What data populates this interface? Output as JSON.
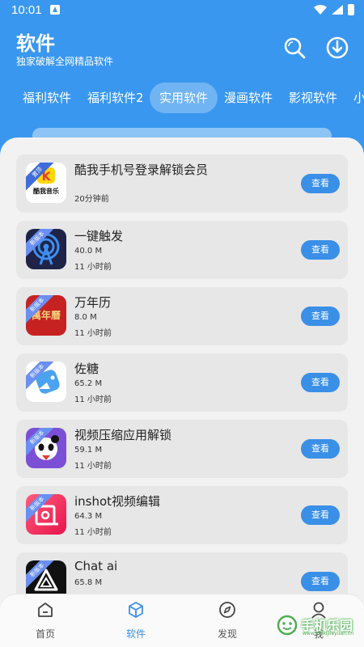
{
  "status": {
    "time": "10:01"
  },
  "header": {
    "title": "软件",
    "subtitle": "独家破解全网精品软件"
  },
  "tabs": [
    {
      "label": "福利软件",
      "active": false
    },
    {
      "label": "福利软件2",
      "active": false
    },
    {
      "label": "实用软件",
      "active": true
    },
    {
      "label": "漫画软件",
      "active": false
    },
    {
      "label": "影视软件",
      "active": false
    },
    {
      "label": "小",
      "active": false
    }
  ],
  "apps": [
    {
      "name": "酷我手机号登录解锁会员",
      "size": "",
      "time": "20分钟前",
      "button": "查看",
      "ribbon": "置顶",
      "icon": "kuwo-music-icon",
      "icon_label": "酷我音乐"
    },
    {
      "name": "一键触发",
      "size": "40.0 M",
      "time": "11 小时前",
      "button": "查看",
      "ribbon": "新版本",
      "icon": "broadcast-icon"
    },
    {
      "name": "万年历",
      "size": "8.0 M",
      "time": "11 小时前",
      "button": "查看",
      "ribbon": "新版本",
      "icon": "calendar-icon",
      "icon_label": "萬年曆"
    },
    {
      "name": "佐糖",
      "size": "65.2 M",
      "time": "11 小时前",
      "button": "查看",
      "ribbon": "新版本",
      "icon": "zuotang-icon"
    },
    {
      "name": "视频压缩应用解锁",
      "size": "59.1 M",
      "time": "11 小时前",
      "button": "查看",
      "ribbon": "新版本",
      "icon": "panda-video-icon"
    },
    {
      "name": "inshot视频编辑",
      "size": "64.3 M",
      "time": "11 小时前",
      "button": "查看",
      "ribbon": "新版本",
      "icon": "inshot-icon"
    },
    {
      "name": "Chat ai",
      "size": "65.8 M",
      "time": "",
      "button": "查看",
      "ribbon": "新版本",
      "icon": "chat-ai-icon"
    }
  ],
  "nav": [
    {
      "label": "首页",
      "icon": "home-icon"
    },
    {
      "label": "软件",
      "icon": "cube-icon"
    },
    {
      "label": "发现",
      "icon": "compass-icon"
    },
    {
      "label": "我",
      "icon": "user-icon"
    }
  ],
  "watermark": {
    "text": "手机乐园",
    "sub": "www.shoujileyuan.cn"
  },
  "colors": {
    "primary": "#3a97ef",
    "button": "#3a8fe6",
    "card": "#e7e7e7",
    "ribbon": "#6a8ff0"
  }
}
